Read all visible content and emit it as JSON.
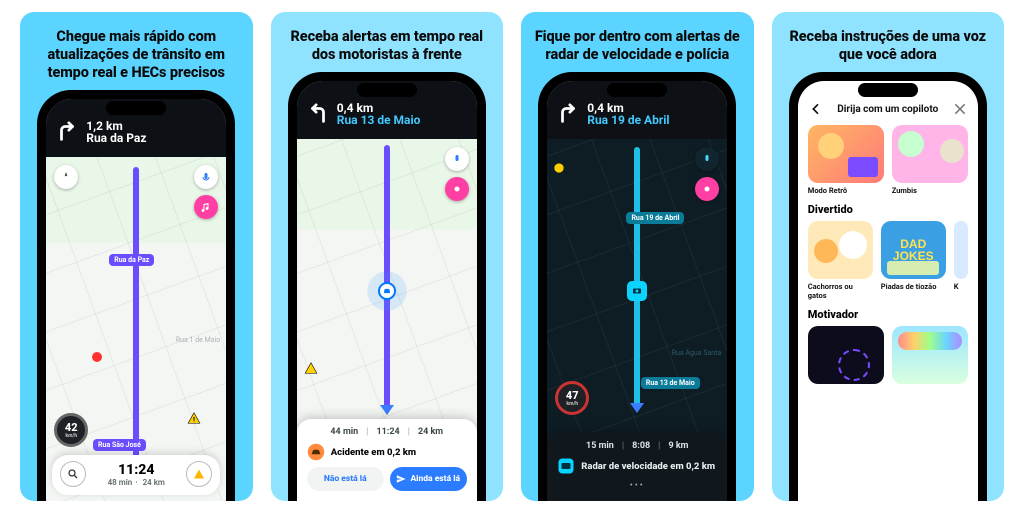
{
  "panels": [
    {
      "headline": "Chegue mais rápido com atualizações de trânsito em tempo real e HECs precisos",
      "banner": {
        "distance": "1,2 km",
        "street": "Rua da Paz",
        "street_color": "white"
      },
      "street_chip": "Rua da Paz",
      "faint_labels": [
        "Rua 1 de Maio"
      ],
      "bottom_chip": "Rua São José",
      "speed": {
        "value": "42",
        "unit": "km/h"
      },
      "eta": {
        "time": "11:24",
        "duration": "48 min",
        "distance": "24 km"
      }
    },
    {
      "headline": "Receba alertas em tempo real dos motoristas à frente",
      "banner": {
        "distance": "0,4 km",
        "street": "Rua 13 de Maio",
        "street_color": "cyan"
      },
      "eta_row": {
        "duration": "44 min",
        "time": "11:24",
        "distance": "24 km"
      },
      "alert": "Acidente em 0,2 km",
      "btn_no": "Não está lá",
      "btn_yes": "Ainda está lá"
    },
    {
      "headline": "Fique por dentro com alertas de radar de velocidade e polícia",
      "banner": {
        "distance": "0,4 km",
        "street": "Rua 19 de Abril",
        "street_color": "cyan"
      },
      "route_labels": [
        "Rua 19 de Abril",
        "Rua 13 de Maio"
      ],
      "faint_labels": [
        "Rua Água Santa"
      ],
      "speed": {
        "value": "47",
        "unit": "km/h"
      },
      "eta_row": {
        "duration": "15 min",
        "time": "8:08",
        "distance": "9 km"
      },
      "alert": "Radar de velocidade em 0,2 km"
    },
    {
      "headline": "Receba instruções de uma voz que você adora",
      "header_title": "Dirija com um copiloto",
      "row1": [
        {
          "caption": "Modo Retrô"
        },
        {
          "caption": "Zumbis"
        }
      ],
      "section_divertido": "Divertido",
      "row2": [
        {
          "caption": "Cachorros ou gatos"
        },
        {
          "caption": "Piadas de tiozão"
        },
        {
          "caption": "K"
        }
      ],
      "dad_text": "DAD JOKES",
      "section_motivador": "Motivador"
    }
  ]
}
